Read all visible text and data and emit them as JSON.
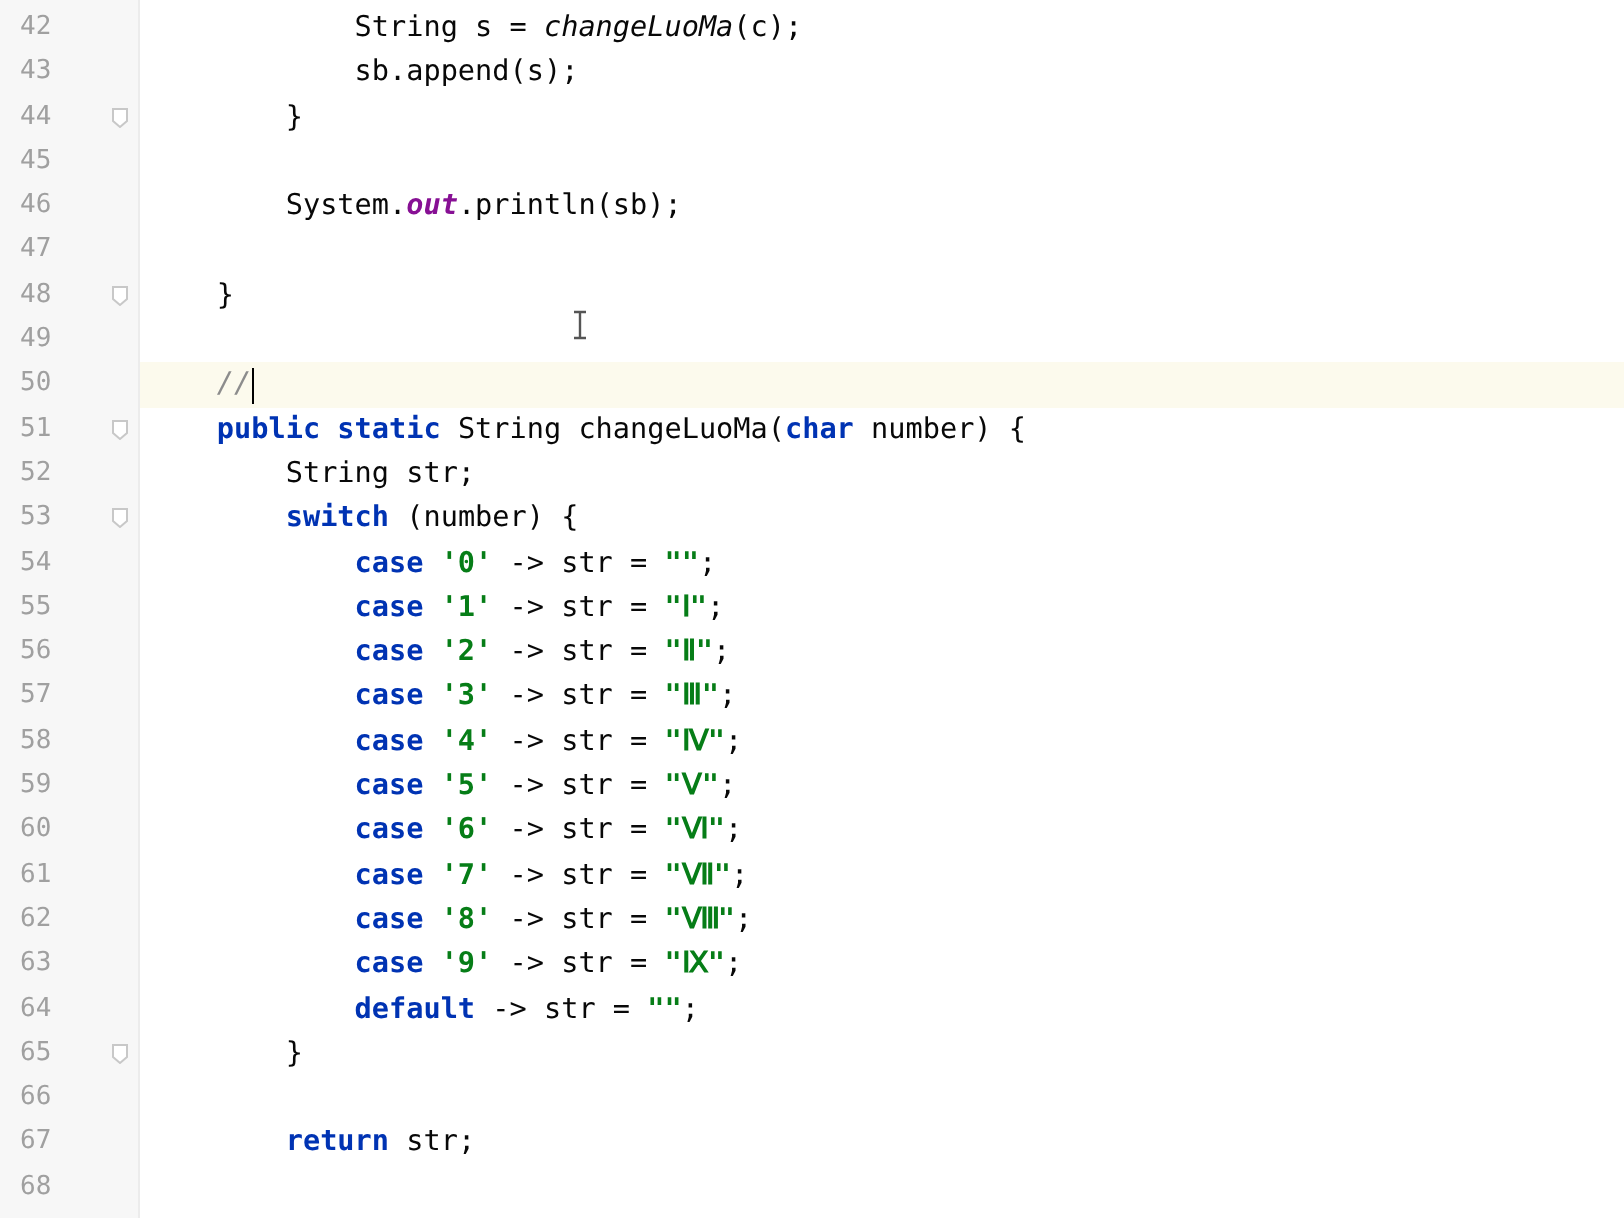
{
  "editor": {
    "lines": [
      {
        "number": "42",
        "current": false,
        "fold": false,
        "tokens": [
          {
            "kind": "plain",
            "text": "            String s = "
          },
          {
            "kind": "italic",
            "text": "changeLuoMa"
          },
          {
            "kind": "plain",
            "text": "(c);"
          }
        ]
      },
      {
        "number": "43",
        "current": false,
        "fold": false,
        "tokens": [
          {
            "kind": "plain",
            "text": "            sb.append(s);"
          }
        ]
      },
      {
        "number": "44",
        "current": false,
        "fold": true,
        "tokens": [
          {
            "kind": "plain",
            "text": "        }"
          }
        ]
      },
      {
        "number": "45",
        "current": false,
        "fold": false
      },
      {
        "number": "46",
        "current": false,
        "fold": false,
        "tokens": [
          {
            "kind": "plain",
            "text": "        System."
          },
          {
            "kind": "field",
            "text": "out"
          },
          {
            "kind": "plain",
            "text": ".println(sb);"
          }
        ]
      },
      {
        "number": "47",
        "current": false,
        "fold": false
      },
      {
        "number": "48",
        "current": false,
        "fold": true,
        "tokens": [
          {
            "kind": "plain",
            "text": "    }"
          }
        ]
      },
      {
        "number": "49",
        "current": false,
        "fold": false
      },
      {
        "number": "50",
        "current": true,
        "fold": false,
        "tokens": [
          {
            "kind": "comment",
            "text": "    //"
          }
        ]
      },
      {
        "number": "51",
        "current": false,
        "fold": true,
        "tokens": [
          {
            "kind": "keyword",
            "text": "    public static "
          },
          {
            "kind": "plain",
            "text": "String changeLuoMa("
          },
          {
            "kind": "keyword",
            "text": "char "
          },
          {
            "kind": "plain",
            "text": "number) {"
          }
        ]
      },
      {
        "number": "52",
        "current": false,
        "fold": false,
        "tokens": [
          {
            "kind": "plain",
            "text": "        String str;"
          }
        ]
      },
      {
        "number": "53",
        "current": false,
        "fold": true,
        "tokens": [
          {
            "kind": "keyword",
            "text": "        switch "
          },
          {
            "kind": "plain",
            "text": "(number) {"
          }
        ]
      },
      {
        "number": "54",
        "current": false,
        "fold": false,
        "tokens": [
          {
            "kind": "keyword",
            "text": "            case "
          },
          {
            "kind": "string",
            "text": "'0'"
          },
          {
            "kind": "plain",
            "text": " -> str = "
          },
          {
            "kind": "string",
            "text": "\"\""
          },
          {
            "kind": "plain",
            "text": ";"
          }
        ]
      },
      {
        "number": "55",
        "current": false,
        "fold": false,
        "tokens": [
          {
            "kind": "keyword",
            "text": "            case "
          },
          {
            "kind": "string",
            "text": "'1'"
          },
          {
            "kind": "plain",
            "text": " -> str = "
          },
          {
            "kind": "string",
            "text": "\"Ⅰ\""
          },
          {
            "kind": "plain",
            "text": ";"
          }
        ]
      },
      {
        "number": "56",
        "current": false,
        "fold": false,
        "tokens": [
          {
            "kind": "keyword",
            "text": "            case "
          },
          {
            "kind": "string",
            "text": "'2'"
          },
          {
            "kind": "plain",
            "text": " -> str = "
          },
          {
            "kind": "string",
            "text": "\"Ⅱ\""
          },
          {
            "kind": "plain",
            "text": ";"
          }
        ]
      },
      {
        "number": "57",
        "current": false,
        "fold": false,
        "tokens": [
          {
            "kind": "keyword",
            "text": "            case "
          },
          {
            "kind": "string",
            "text": "'3'"
          },
          {
            "kind": "plain",
            "text": " -> str = "
          },
          {
            "kind": "string",
            "text": "\"Ⅲ\""
          },
          {
            "kind": "plain",
            "text": ";"
          }
        ]
      },
      {
        "number": "58",
        "current": false,
        "fold": false,
        "tokens": [
          {
            "kind": "keyword",
            "text": "            case "
          },
          {
            "kind": "string",
            "text": "'4'"
          },
          {
            "kind": "plain",
            "text": " -> str = "
          },
          {
            "kind": "string",
            "text": "\"Ⅳ\""
          },
          {
            "kind": "plain",
            "text": ";"
          }
        ]
      },
      {
        "number": "59",
        "current": false,
        "fold": false,
        "tokens": [
          {
            "kind": "keyword",
            "text": "            case "
          },
          {
            "kind": "string",
            "text": "'5'"
          },
          {
            "kind": "plain",
            "text": " -> str = "
          },
          {
            "kind": "string",
            "text": "\"Ⅴ\""
          },
          {
            "kind": "plain",
            "text": ";"
          }
        ]
      },
      {
        "number": "60",
        "current": false,
        "fold": false,
        "tokens": [
          {
            "kind": "keyword",
            "text": "            case "
          },
          {
            "kind": "string",
            "text": "'6'"
          },
          {
            "kind": "plain",
            "text": " -> str = "
          },
          {
            "kind": "string",
            "text": "\"Ⅵ\""
          },
          {
            "kind": "plain",
            "text": ";"
          }
        ]
      },
      {
        "number": "61",
        "current": false,
        "fold": false,
        "tokens": [
          {
            "kind": "keyword",
            "text": "            case "
          },
          {
            "kind": "string",
            "text": "'7'"
          },
          {
            "kind": "plain",
            "text": " -> str = "
          },
          {
            "kind": "string",
            "text": "\"Ⅶ\""
          },
          {
            "kind": "plain",
            "text": ";"
          }
        ]
      },
      {
        "number": "62",
        "current": false,
        "fold": false,
        "tokens": [
          {
            "kind": "keyword",
            "text": "            case "
          },
          {
            "kind": "string",
            "text": "'8'"
          },
          {
            "kind": "plain",
            "text": " -> str = "
          },
          {
            "kind": "string",
            "text": "\"Ⅷ\""
          },
          {
            "kind": "plain",
            "text": ";"
          }
        ]
      },
      {
        "number": "63",
        "current": false,
        "fold": false,
        "tokens": [
          {
            "kind": "keyword",
            "text": "            case "
          },
          {
            "kind": "string",
            "text": "'9'"
          },
          {
            "kind": "plain",
            "text": " -> str = "
          },
          {
            "kind": "string",
            "text": "\"Ⅸ\""
          },
          {
            "kind": "plain",
            "text": ";"
          }
        ]
      },
      {
        "number": "64",
        "current": false,
        "fold": false,
        "tokens": [
          {
            "kind": "keyword",
            "text": "            default "
          },
          {
            "kind": "plain",
            "text": "-> str = "
          },
          {
            "kind": "string",
            "text": "\"\""
          },
          {
            "kind": "plain",
            "text": ";"
          }
        ]
      },
      {
        "number": "65",
        "current": false,
        "fold": true,
        "tokens": [
          {
            "kind": "plain",
            "text": "        }"
          }
        ]
      },
      {
        "number": "66",
        "current": false,
        "fold": false
      },
      {
        "number": "67",
        "current": false,
        "fold": false,
        "tokens": [
          {
            "kind": "keyword",
            "text": "        return "
          },
          {
            "kind": "plain",
            "text": "str;"
          }
        ]
      },
      {
        "number": "68",
        "current": false,
        "fold": false
      }
    ]
  }
}
